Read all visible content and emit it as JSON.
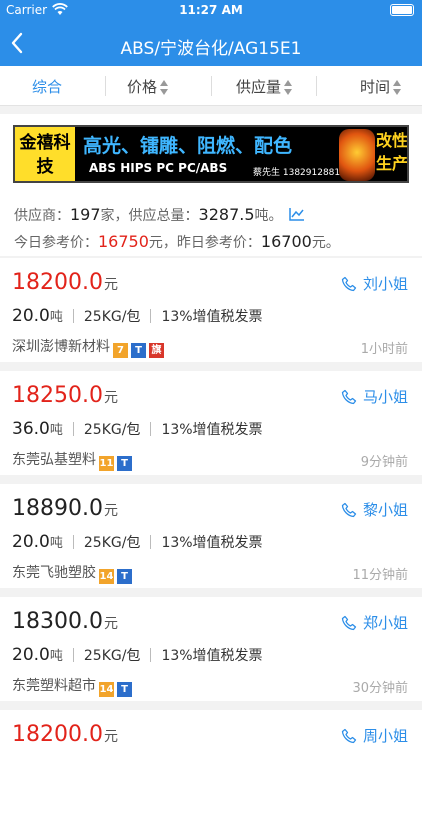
{
  "status_bar": {
    "carrier": "Carrier",
    "time": "11:27 AM"
  },
  "nav": {
    "back_icon": "chevron-left-icon",
    "title": "ABS/宁波台化/AG15E1"
  },
  "filters": [
    {
      "label": "综合",
      "active": true
    },
    {
      "label": "价格",
      "active": false
    },
    {
      "label": "供应量",
      "active": false
    },
    {
      "label": "时间",
      "active": false
    }
  ],
  "banner": {
    "brand": "金禧科技",
    "headline": "高光、镭雕、阻燃、配色",
    "materials": "ABS  HIPS PC  PC/ABS",
    "contact": "蔡先生 13829128818",
    "slogan": "改性生产"
  },
  "summary": {
    "supplier_prefix": "供应商：",
    "supplier_count": "197",
    "supplier_suffix": "家，供应总量：",
    "total_supply": "3287.5",
    "total_suffix": "吨。",
    "today_prefix": "今日参考价：",
    "today_price": "16750",
    "today_suffix": "元，昨日参考价：",
    "yesterday_price": "16700",
    "yesterday_suffix": "元。"
  },
  "listings": [
    {
      "price": "18200.0",
      "price_unit": "元",
      "contact": "刘小姐",
      "qty": "20.0",
      "qty_unit": "吨",
      "pack": "25KG/包",
      "tax": "13%增值税发票",
      "company": "深圳澎博新材料",
      "years": "7",
      "flagship": "旗",
      "ago": "1小时前"
    },
    {
      "price": "18250.0",
      "price_unit": "元",
      "contact": "马小姐",
      "qty": "36.0",
      "qty_unit": "吨",
      "pack": "25KG/包",
      "tax": "13%增值税发票",
      "company": "东莞弘基塑料",
      "years": "11",
      "ago": "9分钟前"
    },
    {
      "price": "18890.0",
      "price_unit": "元",
      "contact": "黎小姐",
      "qty": "20.0",
      "qty_unit": "吨",
      "pack": "25KG/包",
      "tax": "13%增值税发票",
      "company": "东莞飞驰塑胶",
      "years": "14",
      "ago": "11分钟前"
    },
    {
      "price": "18300.0",
      "price_unit": "元",
      "contact": "郑小姐",
      "qty": "20.0",
      "qty_unit": "吨",
      "pack": "25KG/包",
      "tax": "13%增值税发票",
      "company": "东莞塑料超市",
      "years": "14",
      "ago": "30分钟前"
    },
    {
      "price": "18200.0",
      "price_unit": "元",
      "contact": "周小姐"
    }
  ],
  "colors": {
    "primary": "#2c8ee8",
    "price_red": "#e2231a"
  }
}
